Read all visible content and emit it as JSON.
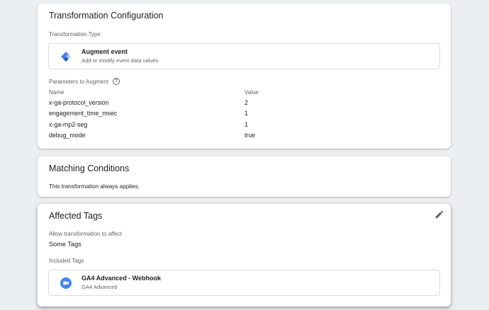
{
  "transformation_config": {
    "title": "Transformation Configuration",
    "type_label": "Transformation Type",
    "type_name": "Augment event",
    "type_desc": "Add or modify event data values",
    "params_label": "Parameters to Augment",
    "help_glyph": "?",
    "col_name": "Name",
    "col_value": "Value",
    "rows": [
      {
        "name": "x-ga-protocol_version",
        "value": "2"
      },
      {
        "name": "engagement_time_msec",
        "value": "1"
      },
      {
        "name": "x-ga-mp2-seg",
        "value": "1"
      },
      {
        "name": "debug_mode",
        "value": "true"
      }
    ]
  },
  "matching_conditions": {
    "title": "Matching Conditions",
    "text": "This transformation always applies."
  },
  "affected_tags": {
    "title": "Affected Tags",
    "allow_label": "Allow transformation to affect",
    "allow_value": "Some Tags",
    "included_label": "Included Tags",
    "tag_name": "GA4 Advanced - Webhook",
    "tag_type": "GA4 Advanced",
    "edit_icon": "pencil-icon"
  },
  "colors": {
    "augment_icon": "#4285f4",
    "tag_icon": "#4285f4"
  }
}
